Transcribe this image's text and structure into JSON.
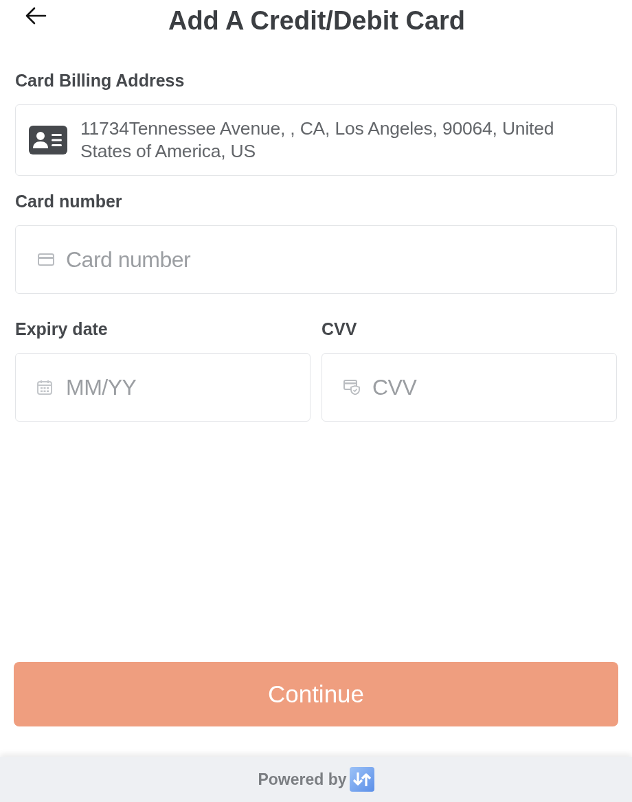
{
  "header": {
    "title": "Add A Credit/Debit Card"
  },
  "billing_address": {
    "label": "Card Billing Address",
    "value": "11734Tennessee Avenue, , CA, Los Angeles, 90064, United States of America, US"
  },
  "rows": [
    [
      {
        "label": "Card number",
        "placeholder": "Card number",
        "kind": "card"
      }
    ],
    [
      {
        "label": "Expiry date",
        "placeholder": "MM/YY",
        "kind": "calendar"
      },
      {
        "label": "CVV",
        "placeholder": "CVV",
        "kind": "cvv"
      }
    ]
  ],
  "continue_button": {
    "label": "Continue",
    "disabled": true
  },
  "footer": {
    "text": "Powered by"
  }
}
